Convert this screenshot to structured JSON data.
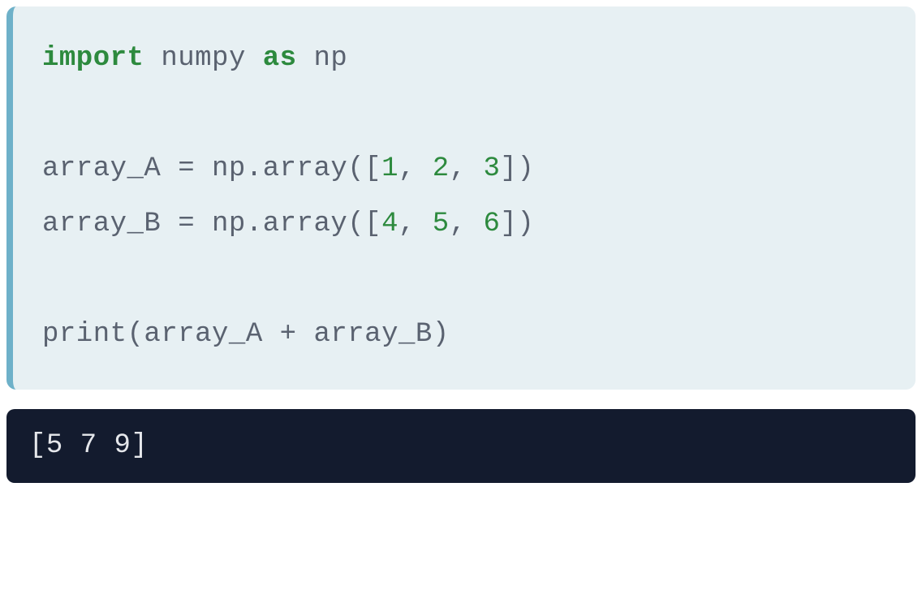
{
  "code": {
    "line1_import": "import",
    "line1_module": " numpy ",
    "line1_as": "as",
    "line1_alias": " np",
    "line2_blank": "",
    "line3_prefix": "array_A = np.array([",
    "line3_n1": "1",
    "line3_sep1": ", ",
    "line3_n2": "2",
    "line3_sep2": ", ",
    "line3_n3": "3",
    "line3_suffix": "])",
    "line4_prefix": "array_B = np.array([",
    "line4_n1": "4",
    "line4_sep1": ", ",
    "line4_n2": "5",
    "line4_sep2": ", ",
    "line4_n3": "6",
    "line4_suffix": "])",
    "line5_blank": "",
    "line6_print": "print(array_A + array_B)"
  },
  "output": {
    "text": "[5 7 9]"
  }
}
